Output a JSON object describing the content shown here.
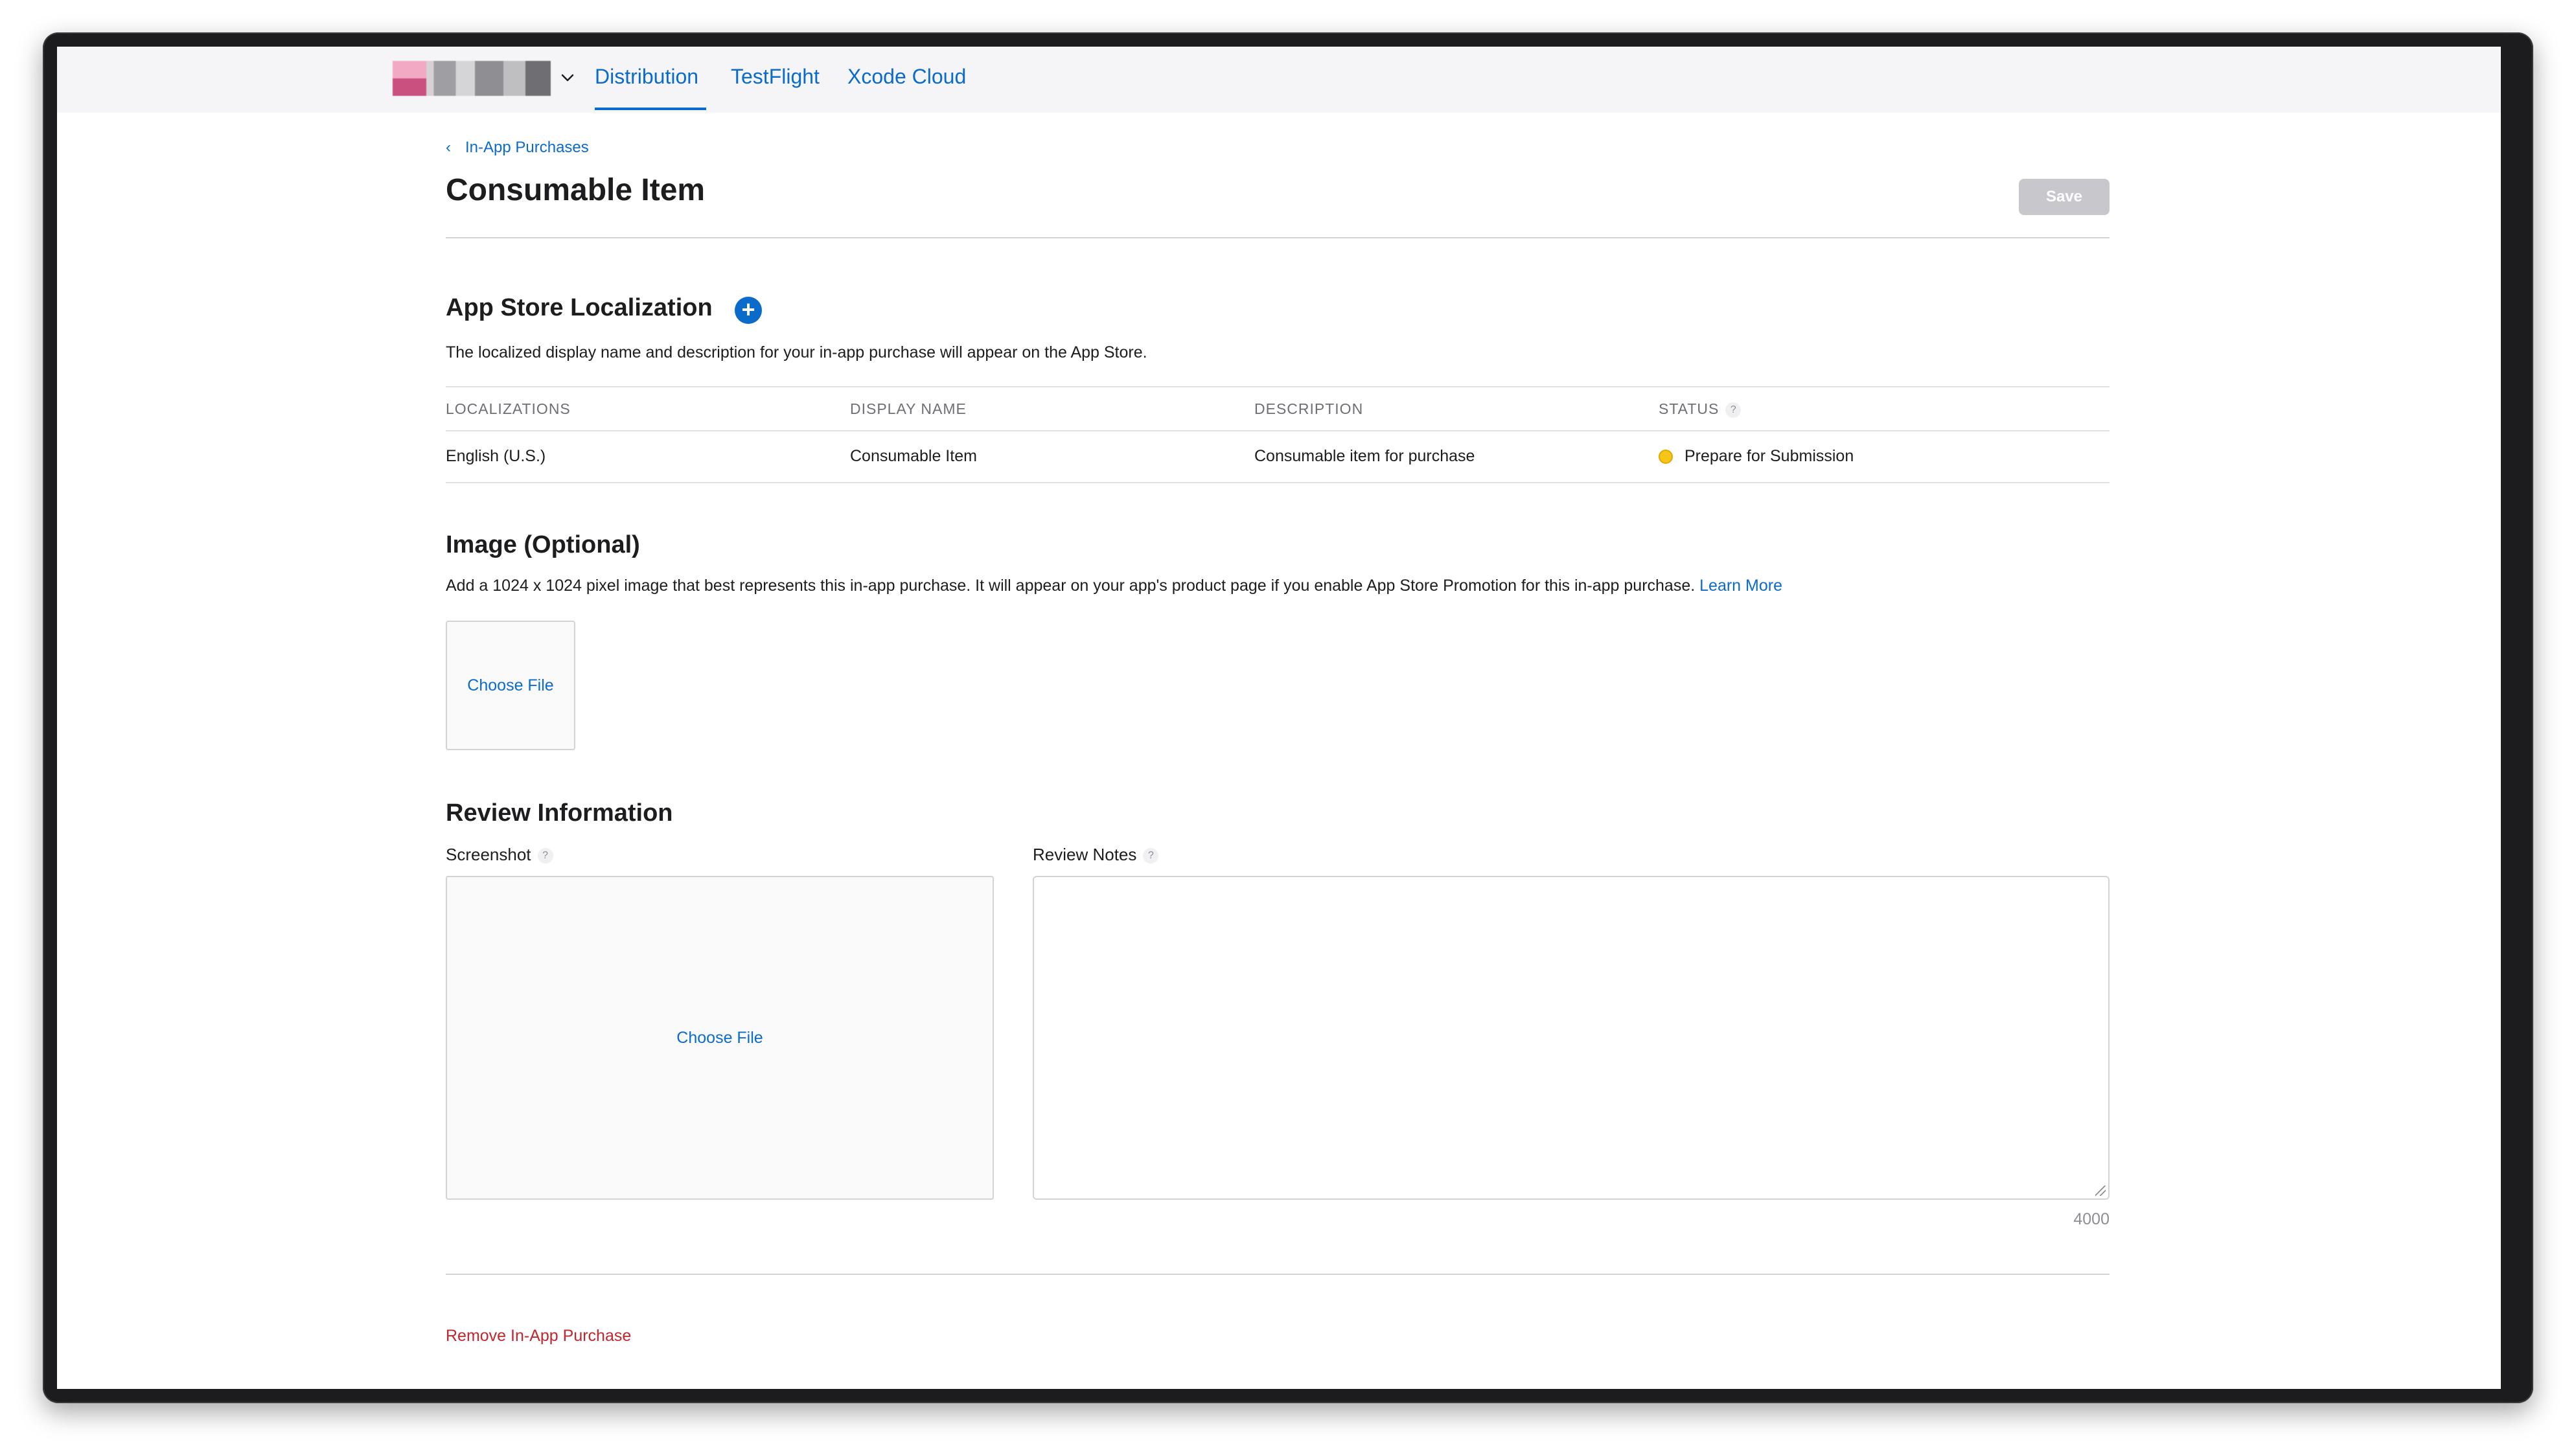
{
  "nav": {
    "tabs": [
      {
        "label": "Distribution",
        "active": true
      },
      {
        "label": "TestFlight",
        "active": false
      },
      {
        "label": "Xcode Cloud",
        "active": false
      }
    ]
  },
  "breadcrumb": {
    "label": "In-App Purchases"
  },
  "page": {
    "title": "Consumable Item"
  },
  "toolbar": {
    "save_label": "Save"
  },
  "localization": {
    "title": "App Store Localization",
    "description": "The localized display name and description for your in-app purchase will appear on the App Store.",
    "columns": [
      "LOCALIZATIONS",
      "DISPLAY NAME",
      "DESCRIPTION",
      "STATUS"
    ],
    "rows": [
      {
        "localization": "English (U.S.)",
        "display_name": "Consumable Item",
        "description": "Consumable item for purchase",
        "status": "Prepare for Submission"
      }
    ]
  },
  "image": {
    "title": "Image (Optional)",
    "description": "Add a 1024 x 1024 pixel image that best represents this in-app purchase. It will appear on your app's product page if you enable App Store Promotion for this in-app purchase.",
    "learn_more": "Learn More",
    "choose_file": "Choose File"
  },
  "review": {
    "title": "Review Information",
    "screenshot_label": "Screenshot",
    "notes_label": "Review Notes",
    "choose_file": "Choose File",
    "notes_value": "",
    "char_count": "4000"
  },
  "footer": {
    "remove_label": "Remove In-App Purchase"
  },
  "colors": {
    "accent": "#0b6bcb",
    "danger": "#c1272d",
    "status_pending": "#f5c518"
  },
  "icons": {
    "chevron": "chevron-down-icon",
    "back": "chevron-left-icon",
    "add": "plus-circle-icon",
    "help": "question-mark-icon"
  }
}
